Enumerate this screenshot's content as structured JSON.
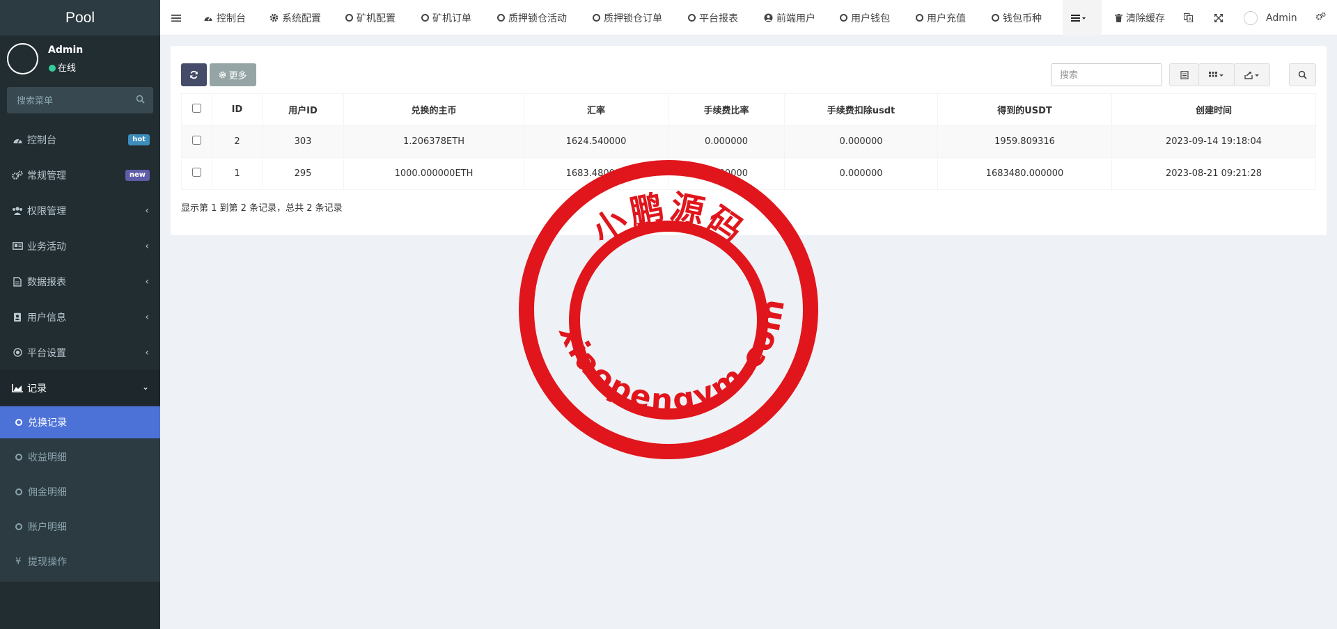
{
  "sidebar": {
    "brand": "Pool",
    "user": {
      "name": "Admin",
      "status": "在线"
    },
    "search": {
      "placeholder": "搜索菜单"
    },
    "items": [
      {
        "label": "控制台",
        "icon": "dashboard-icon",
        "badge": "hot",
        "badge_color": "#3c8dbc"
      },
      {
        "label": "常规管理",
        "icon": "cogs-icon",
        "badge": "new",
        "badge_color": "#605ca8"
      },
      {
        "label": "权限管理",
        "icon": "users-icon"
      },
      {
        "label": "业务活动",
        "icon": "card-icon"
      },
      {
        "label": "数据报表",
        "icon": "file-icon"
      },
      {
        "label": "用户信息",
        "icon": "address-book-icon"
      },
      {
        "label": "平台设置",
        "icon": "target-icon"
      },
      {
        "label": "记录",
        "icon": "area-chart-icon"
      }
    ],
    "subitems": [
      {
        "label": "兑换记录",
        "icon": "circle-icon"
      },
      {
        "label": "收益明细",
        "icon": "circle-icon"
      },
      {
        "label": "佣金明细",
        "icon": "circle-icon"
      },
      {
        "label": "账户明细",
        "icon": "circle-icon"
      },
      {
        "label": "提现操作",
        "icon": "yen-icon",
        "glyph": "¥"
      }
    ]
  },
  "topnav": {
    "tabs": [
      {
        "label": "控制台",
        "icon": "dashboard-icon"
      },
      {
        "label": "系统配置",
        "icon": "gear-icon"
      },
      {
        "label": "矿机配置",
        "icon": "circle-icon"
      },
      {
        "label": "矿机订单",
        "icon": "circle-icon"
      },
      {
        "label": "质押锁仓活动",
        "icon": "circle-icon"
      },
      {
        "label": "质押锁仓订单",
        "icon": "circle-icon"
      },
      {
        "label": "平台报表",
        "icon": "circle-icon"
      },
      {
        "label": "前端用户",
        "icon": "user-circle-icon"
      },
      {
        "label": "用户钱包",
        "icon": "circle-icon"
      },
      {
        "label": "用户充值",
        "icon": "circle-icon"
      },
      {
        "label": "钱包币种",
        "icon": "circle-icon"
      }
    ],
    "clear_cache": "清除缓存",
    "admin": "Admin"
  },
  "toolbar": {
    "more": "更多",
    "search_placeholder": "搜索"
  },
  "table": {
    "columns": [
      "ID",
      "用户ID",
      "兑换的主币",
      "汇率",
      "手续费比率",
      "手续费扣除usdt",
      "得到的USDT",
      "创建时间"
    ],
    "rows": [
      [
        "2",
        "303",
        "1.206378ETH",
        "1624.540000",
        "0.000000",
        "0.000000",
        "1959.809316",
        "2023-09-14 19:18:04"
      ],
      [
        "1",
        "295",
        "1000.000000ETH",
        "1683.480000",
        "0.000000",
        "0.000000",
        "1683480.000000",
        "2023-08-21 09:21:28"
      ]
    ]
  },
  "pagination": {
    "summary": "显示第 1 到第 2 条记录，总共 2 条记录"
  },
  "stamp": {
    "top_text": "小鹏源码",
    "bottom_text": "xiaopengym.com",
    "color": "#e0161c"
  }
}
